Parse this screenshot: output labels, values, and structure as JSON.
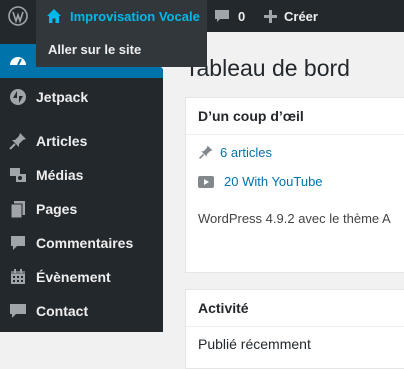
{
  "adminbar": {
    "site_name": "Improvisation Vocale",
    "comments_count": "0",
    "new_label": "Créer",
    "dropdown_item": "Aller sur le site"
  },
  "sidebar": {
    "items": [
      {
        "label": "Jetpack",
        "icon": "jetpack-icon"
      },
      {
        "label": "Articles",
        "icon": "pin-icon"
      },
      {
        "label": "Médias",
        "icon": "media-icon"
      },
      {
        "label": "Pages",
        "icon": "pages-icon"
      },
      {
        "label": "Commentaires",
        "icon": "comment-icon"
      },
      {
        "label": "Évènement",
        "icon": "calendar-icon"
      },
      {
        "label": "Contact",
        "icon": "contact-icon"
      }
    ]
  },
  "main": {
    "title": "Tableau de bord",
    "glance": {
      "title": "D’un coup d’œil",
      "articles": "6 articles",
      "youtube": "20 With YouTube",
      "wp_version": "WordPress 4.9.2 avec le thème A"
    },
    "activity": {
      "title": "Activité",
      "recent": "Publié récemment"
    }
  },
  "colors": {
    "adminbar": "#23282d",
    "accent": "#0073aa",
    "site_link": "#00b9eb",
    "background": "#f1f1f1"
  }
}
